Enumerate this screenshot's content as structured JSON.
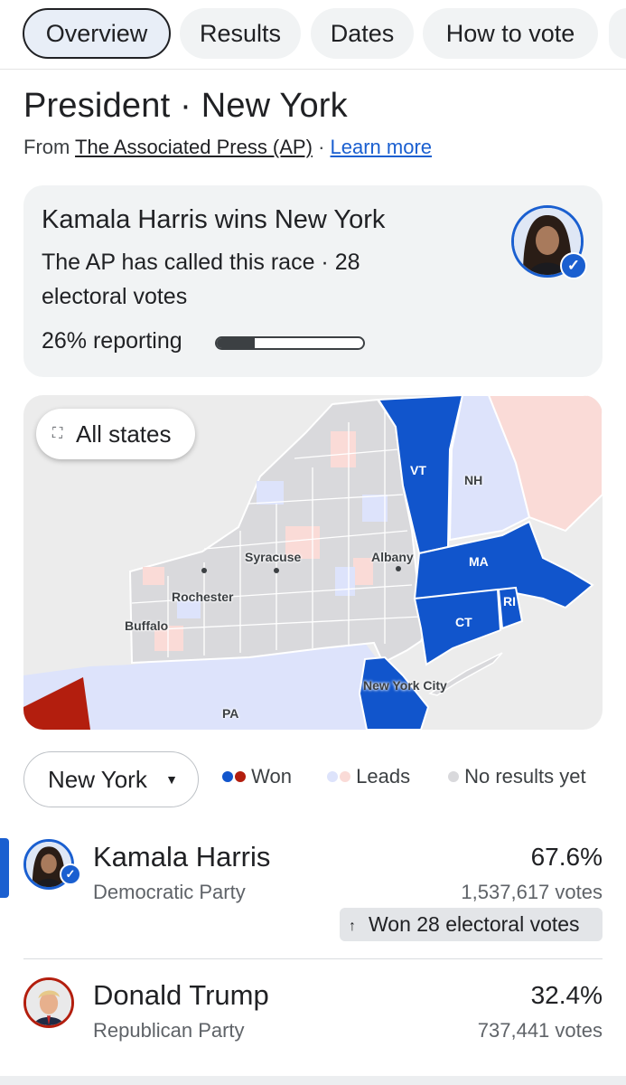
{
  "tabs": [
    "Overview",
    "Results",
    "Dates",
    "How to vote"
  ],
  "title": "President · New York",
  "source": {
    "prefix": "From",
    "name": "The Associated Press (AP)",
    "separator": "·",
    "link": "Learn more"
  },
  "summary": {
    "headline": "Kamala Harris wins New York",
    "detail": "The AP has called this race · 28 electoral votes",
    "reporting_label": "26% reporting",
    "reporting_fraction": 0.26
  },
  "map": {
    "button_label": "All states",
    "expand_icon": "expand-icon",
    "labels": {
      "vt": "VT",
      "nh": "NH",
      "ma": "MA",
      "ct": "CT",
      "ri": "RI",
      "pa": "PA",
      "syracuse": "Syracuse",
      "albany": "Albany",
      "rochester": "Rochester",
      "buffalo": "Buffalo",
      "nyc": "New York City"
    }
  },
  "selector": {
    "value": "New York"
  },
  "legend": {
    "won": "Won",
    "leads": "Leads",
    "no_results": "No results yet"
  },
  "colors": {
    "dem_won": "#1155cc",
    "rep_won": "#b31e0e",
    "dem_lead": "#dde3fb",
    "rep_lead": "#fadbd7",
    "no_results": "#d9d9dc",
    "accent": "#1a5fd0"
  },
  "candidates": [
    {
      "name": "Kamala Harris",
      "party": "Democratic Party",
      "percent": "67.6%",
      "votes": "1,537,617 votes",
      "winner_note": "Won 28 electoral votes"
    },
    {
      "name": "Donald Trump",
      "party": "Republican Party",
      "percent": "32.4%",
      "votes": "737,441 votes"
    }
  ]
}
